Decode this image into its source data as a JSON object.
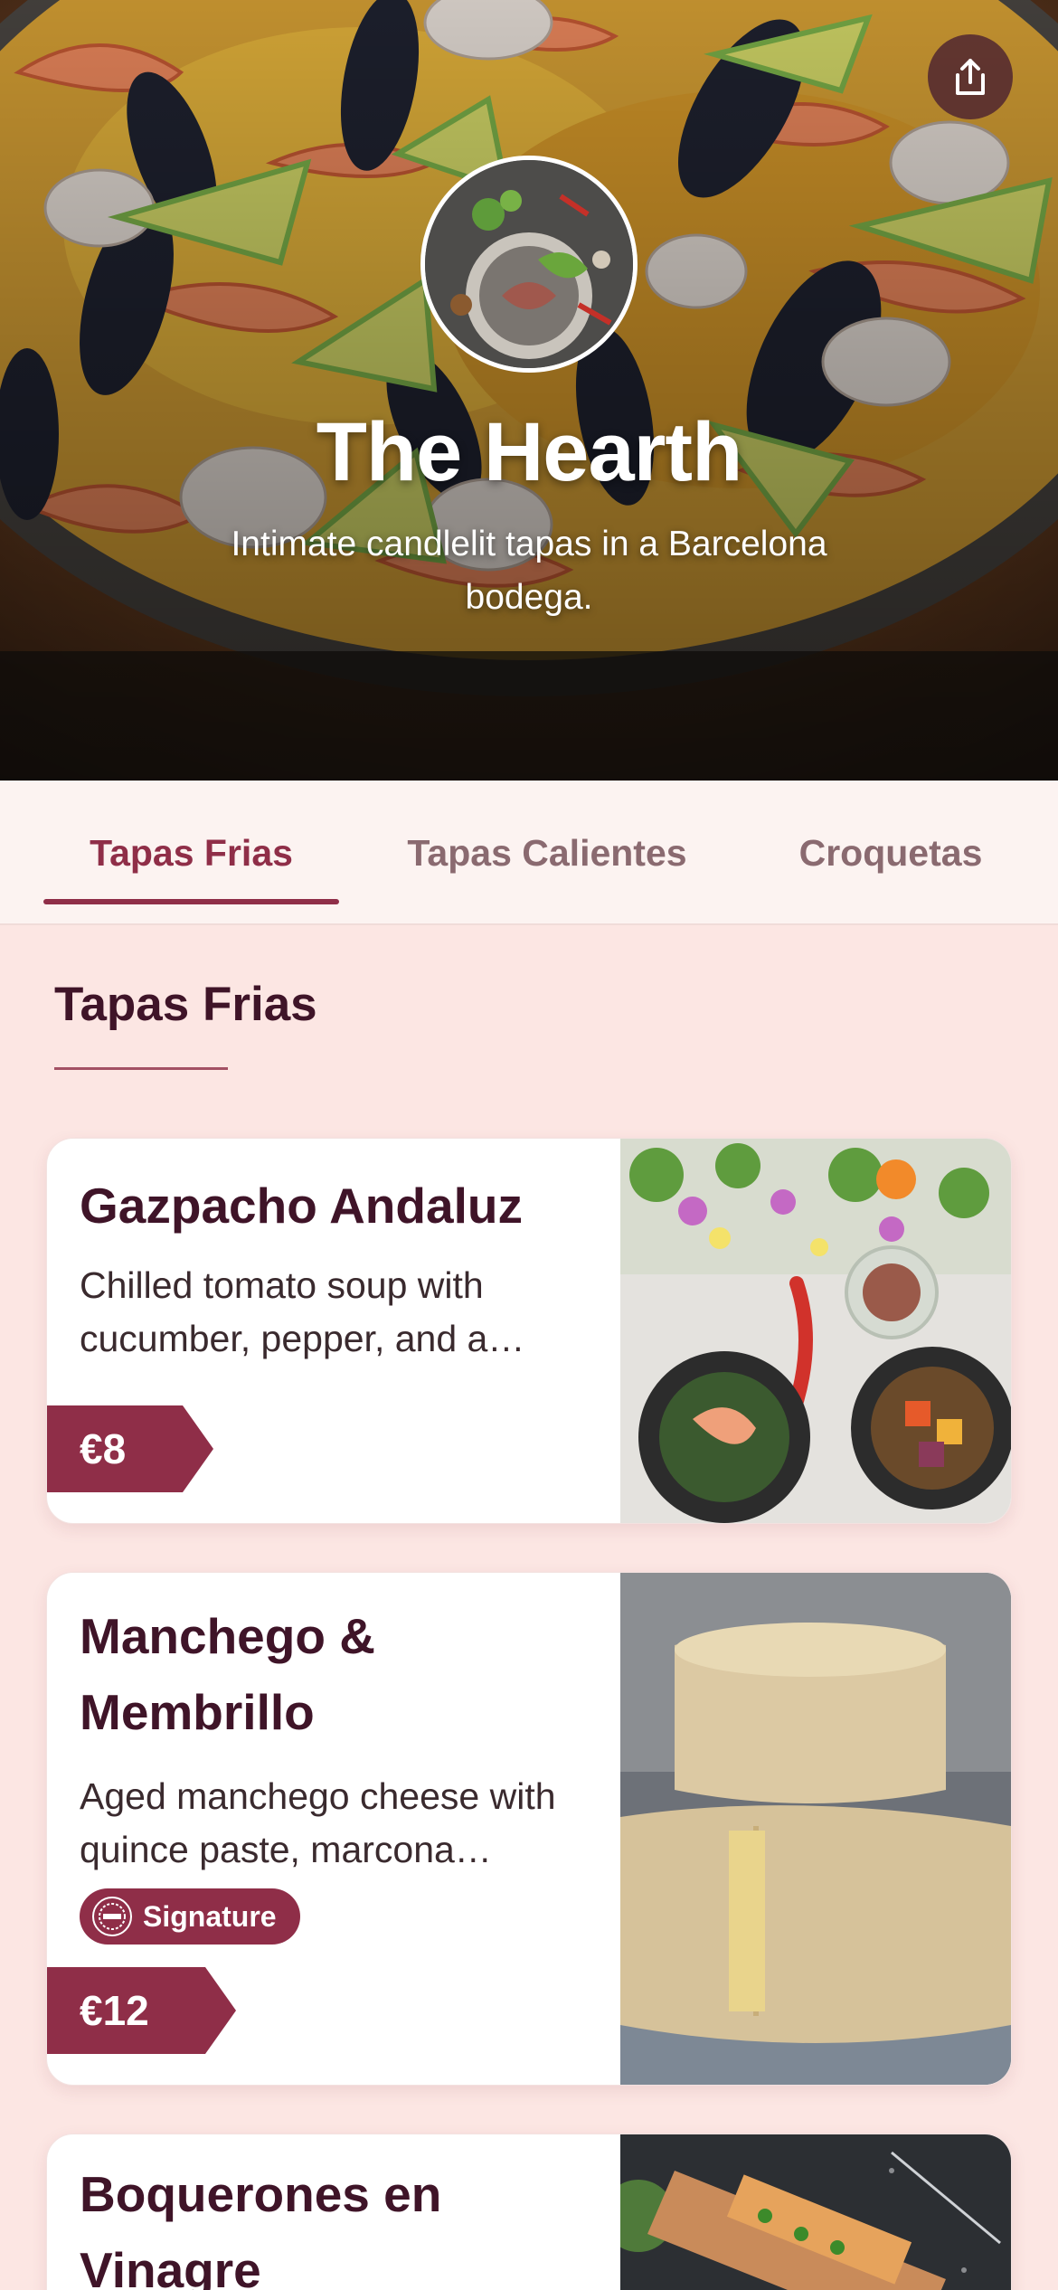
{
  "restaurant": {
    "name": "The Hearth",
    "tagline": "Intimate candlelit tapas in a Barcelona bodega."
  },
  "header": {
    "share_icon": "share-icon"
  },
  "tabs": [
    {
      "label": "Tapas Frias",
      "active": true
    },
    {
      "label": "Tapas Calientes",
      "active": false
    },
    {
      "label": "Croquetas",
      "active": false
    }
  ],
  "section": {
    "title": "Tapas Frias"
  },
  "items": [
    {
      "name": "Gazpacho Andaluz",
      "description_lines": [
        "Chilled tomato soup with",
        "cucumber, pepper, and a…"
      ],
      "price": "€8"
    },
    {
      "name_lines": [
        "Manchego &",
        "Membrillo"
      ],
      "description_lines": [
        "Aged manchego cheese with",
        "quince paste, marcona…"
      ],
      "badge": "Signature",
      "badge_icon_text": "STAFF PICK",
      "price": "€12"
    },
    {
      "name_lines": [
        "Boquerones en",
        "Vinagre"
      ]
    }
  ],
  "colors": {
    "accent": "#8f2e48",
    "page_bg": "#fce6e3",
    "heading": "#3f1428"
  }
}
